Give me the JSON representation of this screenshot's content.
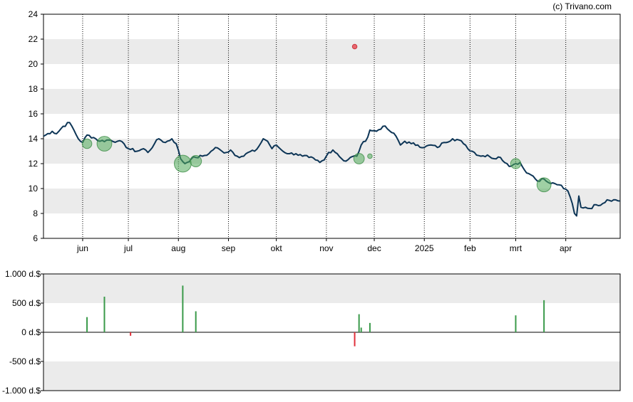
{
  "watermark": "(c) Trivano.com",
  "chart_data": [
    {
      "type": "line",
      "title": "",
      "xlabel": "",
      "ylabel": "",
      "ylim": [
        6,
        24
      ],
      "y_ticks": [
        6,
        8,
        10,
        12,
        14,
        16,
        18,
        20,
        22,
        24
      ],
      "x_tick_labels": [
        {
          "label": "jun",
          "index": 18
        },
        {
          "label": "jul",
          "index": 39
        },
        {
          "label": "aug",
          "index": 62
        },
        {
          "label": "sep",
          "index": 85
        },
        {
          "label": "okt",
          "index": 107
        },
        {
          "label": "nov",
          "index": 130
        },
        {
          "label": "dec",
          "index": 152
        },
        {
          "label": "2025",
          "index": 175
        },
        {
          "label": "feb",
          "index": 196
        },
        {
          "label": "mrt",
          "index": 217
        },
        {
          "label": "apr",
          "index": 240
        }
      ],
      "n_points": 266,
      "grid": "alternating horizontal bands, dotted vertical lines at month ticks",
      "line_color": "#0d3556",
      "price_keypoints": [
        [
          0,
          14.2
        ],
        [
          4,
          14.6
        ],
        [
          6,
          14.4
        ],
        [
          9,
          15.0
        ],
        [
          12,
          15.3
        ],
        [
          14,
          14.7
        ],
        [
          16,
          14.0
        ],
        [
          18,
          13.7
        ],
        [
          20,
          14.3
        ],
        [
          23,
          14.1
        ],
        [
          26,
          13.8
        ],
        [
          30,
          13.9
        ],
        [
          34,
          13.8
        ],
        [
          37,
          13.6
        ],
        [
          39,
          13.2
        ],
        [
          43,
          13.0
        ],
        [
          46,
          13.2
        ],
        [
          48,
          12.9
        ],
        [
          51,
          13.6
        ],
        [
          53,
          14.0
        ],
        [
          56,
          13.7
        ],
        [
          59,
          14.0
        ],
        [
          61,
          13.6
        ],
        [
          63,
          12.4
        ],
        [
          65,
          12.0
        ],
        [
          68,
          12.4
        ],
        [
          70,
          12.5
        ],
        [
          73,
          12.6
        ],
        [
          76,
          12.8
        ],
        [
          79,
          13.3
        ],
        [
          82,
          13.0
        ],
        [
          84,
          12.9
        ],
        [
          86,
          13.1
        ],
        [
          89,
          12.6
        ],
        [
          92,
          12.6
        ],
        [
          94,
          12.9
        ],
        [
          97,
          13.0
        ],
        [
          99,
          13.4
        ],
        [
          101,
          14.0
        ],
        [
          103,
          13.8
        ],
        [
          105,
          13.2
        ],
        [
          107,
          13.5
        ],
        [
          110,
          13.0
        ],
        [
          113,
          12.8
        ],
        [
          116,
          12.8
        ],
        [
          119,
          12.6
        ],
        [
          122,
          12.5
        ],
        [
          125,
          12.3
        ],
        [
          127,
          12.1
        ],
        [
          129,
          12.3
        ],
        [
          131,
          12.9
        ],
        [
          133,
          13.1
        ],
        [
          135,
          12.8
        ],
        [
          137,
          12.4
        ],
        [
          139,
          12.2
        ],
        [
          141,
          12.5
        ],
        [
          144,
          12.6
        ],
        [
          146,
          13.5
        ],
        [
          148,
          13.8
        ],
        [
          150,
          14.7
        ],
        [
          153,
          14.6
        ],
        [
          156,
          15.0
        ],
        [
          158,
          14.8
        ],
        [
          160,
          14.5
        ],
        [
          162,
          14.2
        ],
        [
          164,
          13.5
        ],
        [
          166,
          13.8
        ],
        [
          169,
          13.6
        ],
        [
          172,
          13.5
        ],
        [
          175,
          13.3
        ],
        [
          178,
          13.5
        ],
        [
          181,
          13.3
        ],
        [
          184,
          13.7
        ],
        [
          188,
          14.0
        ],
        [
          191,
          13.9
        ],
        [
          193,
          13.6
        ],
        [
          195,
          13.2
        ],
        [
          198,
          12.9
        ],
        [
          201,
          12.6
        ],
        [
          204,
          12.7
        ],
        [
          207,
          12.4
        ],
        [
          210,
          12.5
        ],
        [
          213,
          12.0
        ],
        [
          215,
          11.8
        ],
        [
          217,
          12.0
        ],
        [
          219,
          12.1
        ],
        [
          221,
          11.5
        ],
        [
          223,
          11.2
        ],
        [
          225,
          11.0
        ],
        [
          227,
          10.6
        ],
        [
          229,
          10.8
        ],
        [
          231,
          10.6
        ],
        [
          233,
          10.4
        ],
        [
          235,
          10.4
        ],
        [
          237,
          10.3
        ],
        [
          239,
          10.0
        ],
        [
          241,
          9.8
        ],
        [
          243,
          8.8
        ],
        [
          244,
          8.0
        ],
        [
          245,
          7.8
        ],
        [
          246,
          9.4
        ],
        [
          247,
          8.5
        ],
        [
          249,
          8.5
        ],
        [
          251,
          8.4
        ],
        [
          254,
          8.7
        ],
        [
          257,
          8.8
        ],
        [
          259,
          9.1
        ],
        [
          262,
          9.1
        ],
        [
          265,
          9.0
        ]
      ],
      "markers": [
        {
          "index": 20,
          "value": 13.6,
          "size": 260,
          "color": "green"
        },
        {
          "index": 28,
          "value": 13.6,
          "size": 610,
          "color": "green"
        },
        {
          "index": 64,
          "value": 12.0,
          "size": 800,
          "color": "green"
        },
        {
          "index": 70,
          "value": 12.2,
          "size": 360,
          "color": "green"
        },
        {
          "index": 143,
          "value": 21.4,
          "size": 60,
          "color": "red"
        },
        {
          "index": 145,
          "value": 12.4,
          "size": 310,
          "color": "green"
        },
        {
          "index": 150,
          "value": 12.6,
          "size": 60,
          "color": "green"
        },
        {
          "index": 217,
          "value": 12.0,
          "size": 290,
          "color": "green"
        },
        {
          "index": 230,
          "value": 10.3,
          "size": 550,
          "color": "green"
        }
      ]
    },
    {
      "type": "bar",
      "title": "",
      "xlabel": "",
      "ylabel": "",
      "ylim": [
        -1000,
        1000
      ],
      "y_ticks": [
        {
          "value": 1000,
          "label": "1.000 d.$"
        },
        {
          "value": 500,
          "label": "500 d.$"
        },
        {
          "value": 0,
          "label": "0 d.$"
        },
        {
          "value": -500,
          "label": "-500 d.$"
        },
        {
          "value": -1000,
          "label": "-1.000 d.$"
        }
      ],
      "bars": [
        {
          "index": 20,
          "value": 260,
          "color": "#3a9a4a"
        },
        {
          "index": 28,
          "value": 610,
          "color": "#3a9a4a"
        },
        {
          "index": 40,
          "value": -60,
          "color": "#e0303a"
        },
        {
          "index": 64,
          "value": 800,
          "color": "#3a9a4a"
        },
        {
          "index": 70,
          "value": 360,
          "color": "#3a9a4a"
        },
        {
          "index": 143,
          "value": -240,
          "color": "#e0303a"
        },
        {
          "index": 145,
          "value": 310,
          "color": "#3a9a4a"
        },
        {
          "index": 146,
          "value": 80,
          "color": "#3a9a4a"
        },
        {
          "index": 150,
          "value": 160,
          "color": "#3a9a4a"
        },
        {
          "index": 217,
          "value": 290,
          "color": "#3a9a4a"
        },
        {
          "index": 230,
          "value": 550,
          "color": "#3a9a4a"
        }
      ]
    }
  ]
}
